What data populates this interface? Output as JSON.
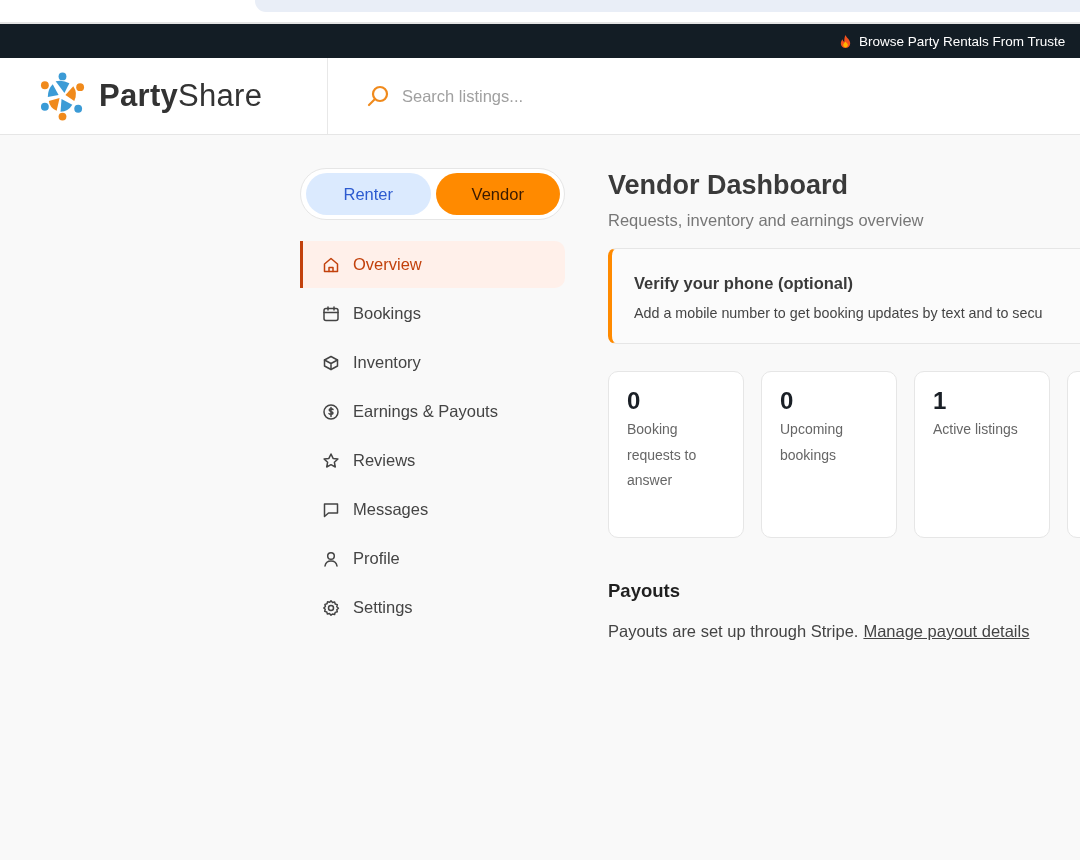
{
  "announcement": {
    "text": "Browse Party Rentals From Truste"
  },
  "header": {
    "logo": "**Party**Share",
    "search": {
      "placeholder": "Search listings..."
    }
  },
  "mode_toggle": [
    {
      "label": "Renter",
      "selected": false
    },
    {
      "label": "Vendor",
      "selected": true
    }
  ],
  "sidebar": {
    "items": [
      {
        "label": "Overview",
        "kind": "home",
        "selected": true
      },
      {
        "label": "Bookings",
        "kind": "calendar",
        "selected": false
      },
      {
        "label": "Inventory",
        "kind": "box",
        "selected": false
      },
      {
        "label": "Earnings & Payouts",
        "kind": "dollar",
        "selected": false
      },
      {
        "label": "Reviews",
        "kind": "star",
        "selected": false
      },
      {
        "label": "Messages",
        "kind": "message",
        "selected": false
      },
      {
        "label": "Profile",
        "kind": "user",
        "selected": false
      },
      {
        "label": "Settings",
        "kind": "gear",
        "selected": false
      }
    ]
  },
  "main": {
    "title": "Vendor Dashboard",
    "subtitle": "Requests, inventory and earnings overview",
    "notice": {
      "title": "Verify your phone (optional)",
      "text": "Add a mobile number to get booking updates by text and to secu"
    },
    "cards": [
      {
        "kind": "stat",
        "value": "0",
        "label": "Booking requests to answer"
      },
      {
        "kind": "stat",
        "value": "0",
        "label": "Upcoming bookings"
      },
      {
        "kind": "stat",
        "value": "1",
        "label": "Active listings"
      },
      {
        "kind": "clipped"
      }
    ],
    "payouts": {
      "title": "Payouts",
      "text": "Payouts are set up through Stripe.",
      "link": "Manage payout details"
    }
  }
}
